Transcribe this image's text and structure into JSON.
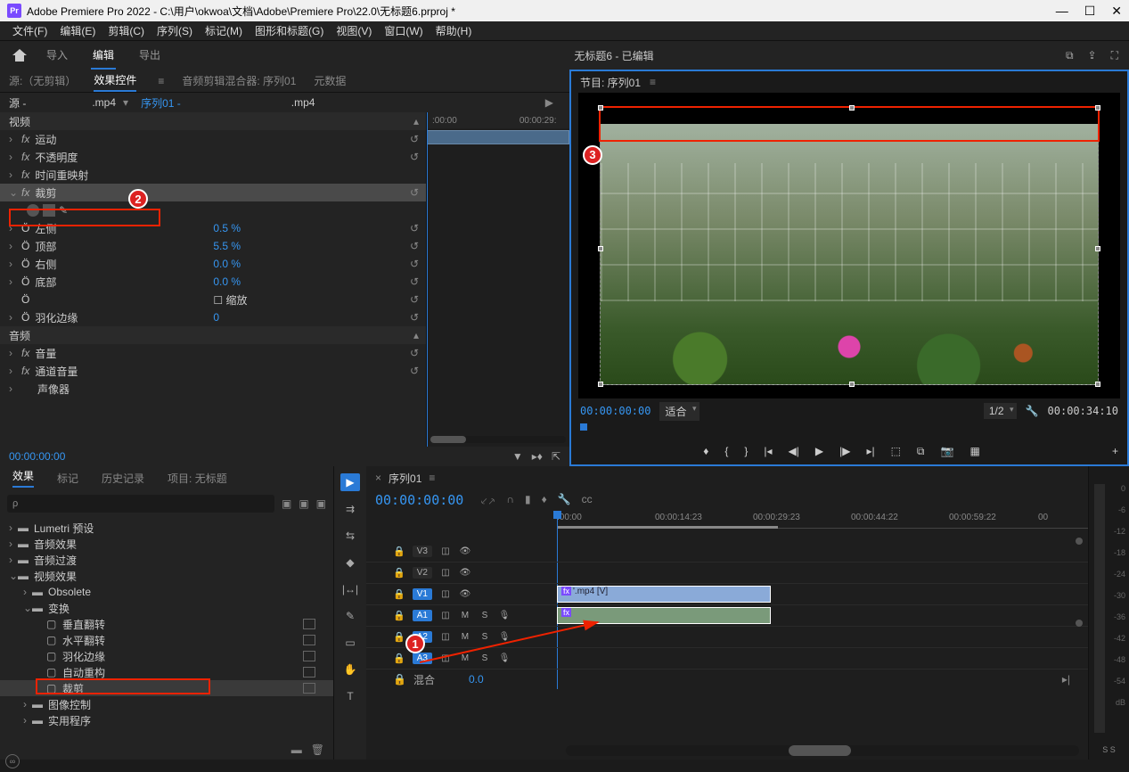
{
  "titlebar": {
    "app_icon": "Pr",
    "title": "Adobe Premiere Pro 2022 - C:\\用户\\okwoa\\文档\\Adobe\\Premiere Pro\\22.0\\无标题6.prproj *"
  },
  "menubar": [
    "文件(F)",
    "编辑(E)",
    "剪辑(C)",
    "序列(S)",
    "标记(M)",
    "图形和标题(G)",
    "视图(V)",
    "窗口(W)",
    "帮助(H)"
  ],
  "topbar": {
    "tabs": [
      "导入",
      "编辑",
      "导出"
    ],
    "active_tab": "编辑",
    "project_status": "无标题6 - 已编辑"
  },
  "effect_controls": {
    "tabs": [
      "源:（无剪辑）",
      "效果控件",
      "音频剪辑混合器: 序列01",
      "元数据"
    ],
    "active_tab": "效果控件",
    "burger": "≡",
    "source_line": {
      "prefix": "源 -",
      "ext_a": ".mp4",
      "seq": "序列01 -",
      "ext_b": ".mp4"
    },
    "ruler": {
      "t0": ":00:00",
      "t1": "00:00:29:"
    },
    "sections": {
      "video": "视频",
      "motion": "运动",
      "opacity": "不透明度",
      "time_remap": "时间重映射",
      "crop": "裁剪",
      "crop_params": [
        {
          "name": "左侧",
          "val": "0.5 %"
        },
        {
          "name": "顶部",
          "val": "5.5 %"
        },
        {
          "name": "右侧",
          "val": "0.0 %"
        },
        {
          "name": "底部",
          "val": "0.0 %"
        },
        {
          "name": "缩放",
          "checkbox": true
        },
        {
          "name": "羽化边缘",
          "val": "0"
        }
      ],
      "audio": "音频",
      "volume": "音量",
      "ch_volume": "通道音量",
      "panner": "声像器"
    },
    "footer_tc": "00:00:00:00"
  },
  "program_monitor": {
    "title": "节目: 序列01",
    "burger": "≡",
    "tc_in": "00:00:00:00",
    "fit": "适合",
    "res": "1/2",
    "tc_out": "00:00:34:10"
  },
  "effects_browser": {
    "tabs": [
      "效果",
      "标记",
      "历史记录",
      "项目: 无标题"
    ],
    "active_tab": "效果",
    "search_placeholder": "ρ",
    "tree": [
      {
        "label": "Lumetri 预设",
        "lvl": 0,
        "chev": "›",
        "icon": "folder"
      },
      {
        "label": "音频效果",
        "lvl": 0,
        "chev": "›",
        "icon": "folder"
      },
      {
        "label": "音频过渡",
        "lvl": 0,
        "chev": "›",
        "icon": "folder"
      },
      {
        "label": "视频效果",
        "lvl": 0,
        "chev": "⌄",
        "icon": "folder"
      },
      {
        "label": "Obsolete",
        "lvl": 1,
        "chev": "›",
        "icon": "folder"
      },
      {
        "label": "变换",
        "lvl": 1,
        "chev": "⌄",
        "icon": "folder"
      },
      {
        "label": "垂直翻转",
        "lvl": 2,
        "icon": "preset",
        "badge": true
      },
      {
        "label": "水平翻转",
        "lvl": 2,
        "icon": "preset",
        "badge": true
      },
      {
        "label": "羽化边缘",
        "lvl": 2,
        "icon": "preset",
        "badge": true
      },
      {
        "label": "自动重构",
        "lvl": 2,
        "icon": "preset",
        "badge": true
      },
      {
        "label": "裁剪",
        "lvl": 2,
        "icon": "preset",
        "badge": true,
        "sel": true
      },
      {
        "label": "图像控制",
        "lvl": 1,
        "chev": "›",
        "icon": "folder"
      },
      {
        "label": "实用程序",
        "lvl": 1,
        "chev": "›",
        "icon": "folder"
      }
    ]
  },
  "timeline": {
    "seq_name": "序列01",
    "tc": "00:00:00:00",
    "ruler": [
      ":00:00",
      "00:00:14:23",
      "00:00:29:23",
      "00:00:44:22",
      "00:00:59:22",
      "00"
    ],
    "tracks_v": [
      "V3",
      "V2",
      "V1"
    ],
    "tracks_a": [
      "A1",
      "A2",
      "A3"
    ],
    "clip_v": "'.mp4 [V]",
    "mix": {
      "label": "混合",
      "val": "0.0"
    }
  },
  "markers": {
    "m1": "1",
    "m2": "2",
    "m3": "3"
  },
  "meter": {
    "labels": [
      "0",
      "-6",
      "-12",
      "-18",
      "-24",
      "-30",
      "-36",
      "-42",
      "-48",
      "-54",
      "dB"
    ],
    "ss": "S  S"
  }
}
